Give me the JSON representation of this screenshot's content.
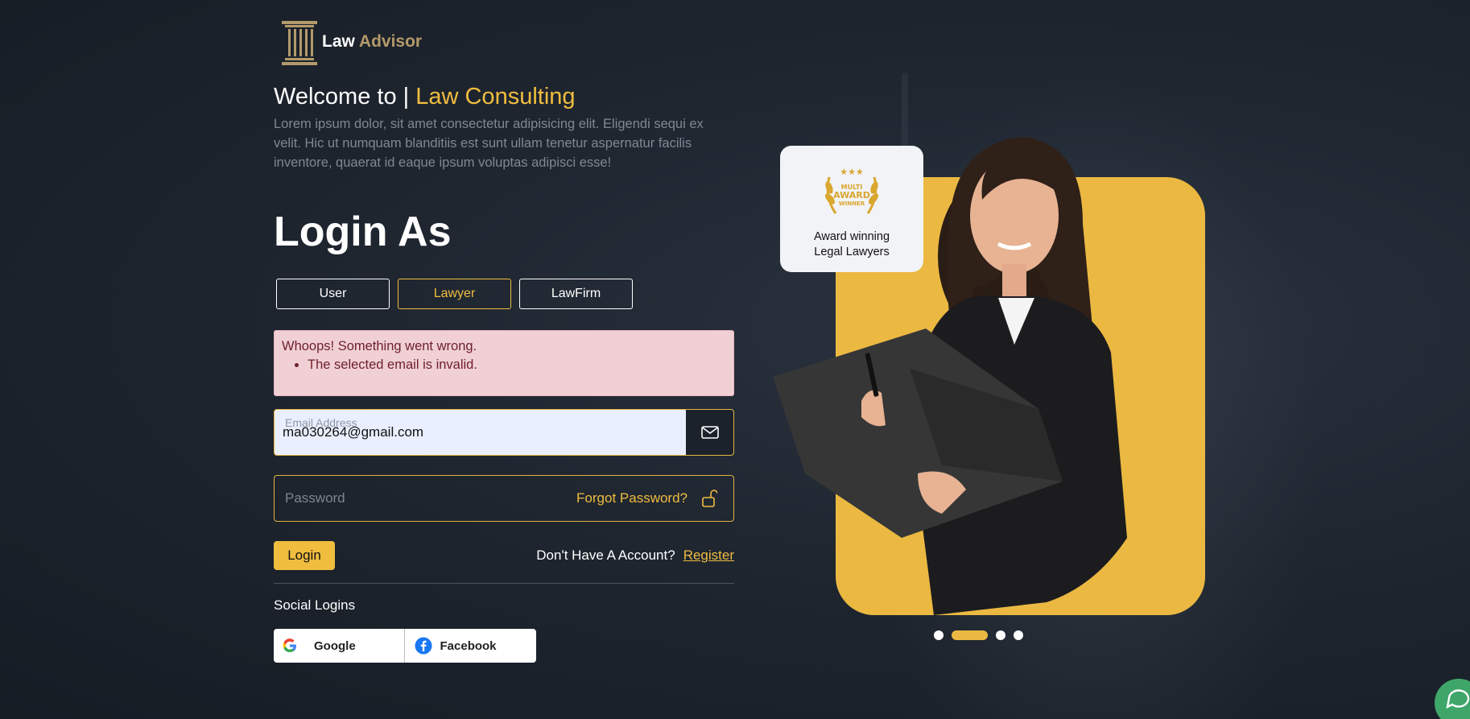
{
  "brand": {
    "name_part1": "Law",
    "name_part2": "Advisor"
  },
  "welcome": {
    "prefix": "Welcome to | ",
    "highlight": "Law Consulting"
  },
  "lead_text": "Lorem ipsum dolor, sit amet consectetur adipisicing elit. Eligendi sequi ex velit. Hic ut numquam blanditiis est sunt ullam tenetur aspernatur facilis inventore, quaerat id eaque ipsum voluptas adipisci esse!",
  "login": {
    "title": "Login As",
    "roles": [
      {
        "label": "User",
        "active": false
      },
      {
        "label": "Lawyer",
        "active": true
      },
      {
        "label": "LawFirm",
        "active": false
      }
    ],
    "alert": {
      "heading": "Whoops! Something went wrong.",
      "errors": [
        "The selected email is invalid."
      ]
    },
    "email": {
      "label": "Email Address",
      "value": "ma030264@gmail.com"
    },
    "password": {
      "placeholder": "Password",
      "forgot": "Forgot Password?"
    },
    "submit": "Login",
    "no_account": "Don't Have A Account?",
    "register": "Register"
  },
  "social": {
    "title": "Social Logins",
    "google": "Google",
    "facebook": "Facebook"
  },
  "award": {
    "badge_line1": "MULTI",
    "badge_line2": "AWARD",
    "badge_line3": "WINNER",
    "text_line1": "Award winning",
    "text_line2": "Legal Lawyers"
  },
  "carousel": {
    "slides": 4,
    "active_index": 1
  },
  "colors": {
    "accent": "#f0bd3f",
    "hero_bg": "#ebb842",
    "alert_bg": "#f0d0d5",
    "chat": "#3fa66a"
  }
}
